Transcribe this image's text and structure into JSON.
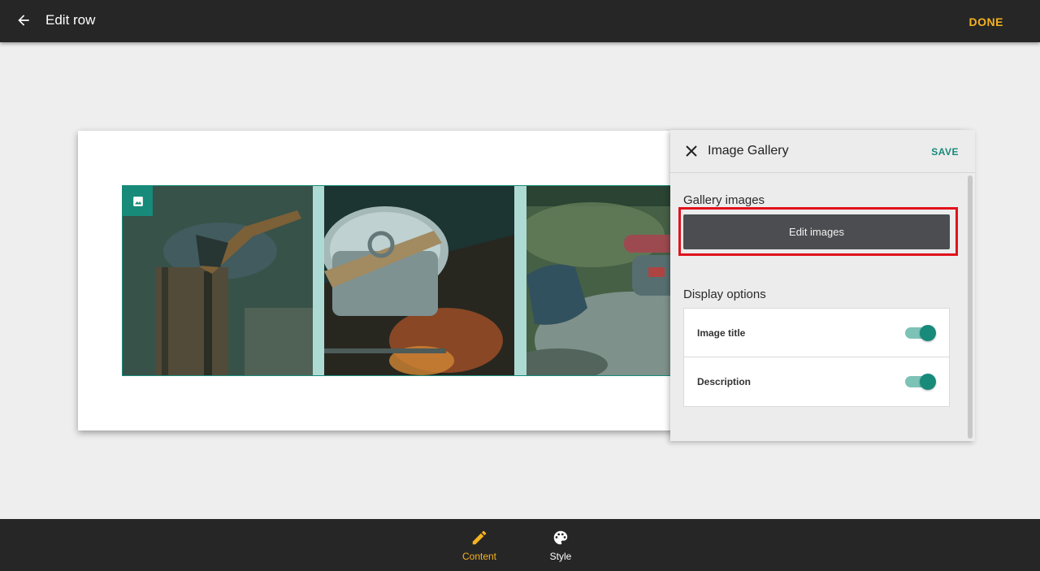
{
  "topbar": {
    "title": "Edit row",
    "done_label": "DONE",
    "back_icon": "arrow-left-icon"
  },
  "gallery": {
    "badge_icon": "image-icon",
    "images": [
      "campfire-axe-photo",
      "campfire-pot-photo",
      "camping-gear-photo"
    ]
  },
  "panel": {
    "title": "Image Gallery",
    "save_label": "SAVE",
    "close_icon": "close-icon",
    "gallery_section_title": "Gallery images",
    "edit_images_label": "Edit images",
    "display_section_title": "Display options",
    "options": [
      {
        "label": "Image title",
        "enabled": true
      },
      {
        "label": "Description",
        "enabled": true
      }
    ]
  },
  "bottombar": {
    "tabs": [
      {
        "label": "Content",
        "icon": "pencil-icon",
        "active": true
      },
      {
        "label": "Style",
        "icon": "palette-icon",
        "active": false
      }
    ]
  },
  "colors": {
    "accent": "#f5b21f",
    "teal": "#178a7a",
    "highlight": "#e1121b",
    "bar_background": "#262626"
  }
}
